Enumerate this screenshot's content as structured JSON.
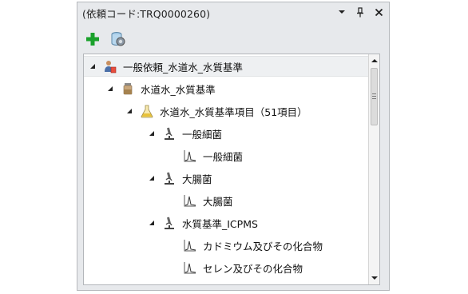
{
  "panel": {
    "title": "(依頼コード:TRQ0000260)",
    "controls": {
      "dropdown_icon": "chevron-down-icon",
      "pin_icon": "pin-icon",
      "close_icon": "close-icon"
    }
  },
  "toolbar": {
    "add_icon": "plus-icon",
    "db_icon": "database-icon"
  },
  "tree": [
    {
      "label": "一般依頼_水道水_水質基準",
      "icon": "person-request-icon",
      "level": 0,
      "expanded": true,
      "selected": true
    },
    {
      "label": "水道水_水質基準",
      "icon": "container-icon",
      "level": 1,
      "expanded": true
    },
    {
      "label": "水道水_水質基準項目（51項目）",
      "icon": "flask-icon",
      "level": 2,
      "expanded": true
    },
    {
      "label": "一般細菌",
      "icon": "microscope-icon",
      "level": 3,
      "expanded": true
    },
    {
      "label": "一般細菌",
      "icon": "chromatogram-icon",
      "level": 4
    },
    {
      "label": "大腸菌",
      "icon": "microscope-icon",
      "level": 3,
      "expanded": true
    },
    {
      "label": "大腸菌",
      "icon": "chromatogram-icon",
      "level": 4
    },
    {
      "label": "水質基準_ICPMS",
      "icon": "microscope-icon",
      "level": 3,
      "expanded": true
    },
    {
      "label": "カドミウム及びその化合物",
      "icon": "chromatogram-icon",
      "level": 4
    },
    {
      "label": "セレン及びその化合物",
      "icon": "chromatogram-icon",
      "level": 4
    }
  ],
  "colors": {
    "add_green": "#1aa12b",
    "panel_bg": "#e7e9ec",
    "selection_bg": "#eef0f2"
  }
}
